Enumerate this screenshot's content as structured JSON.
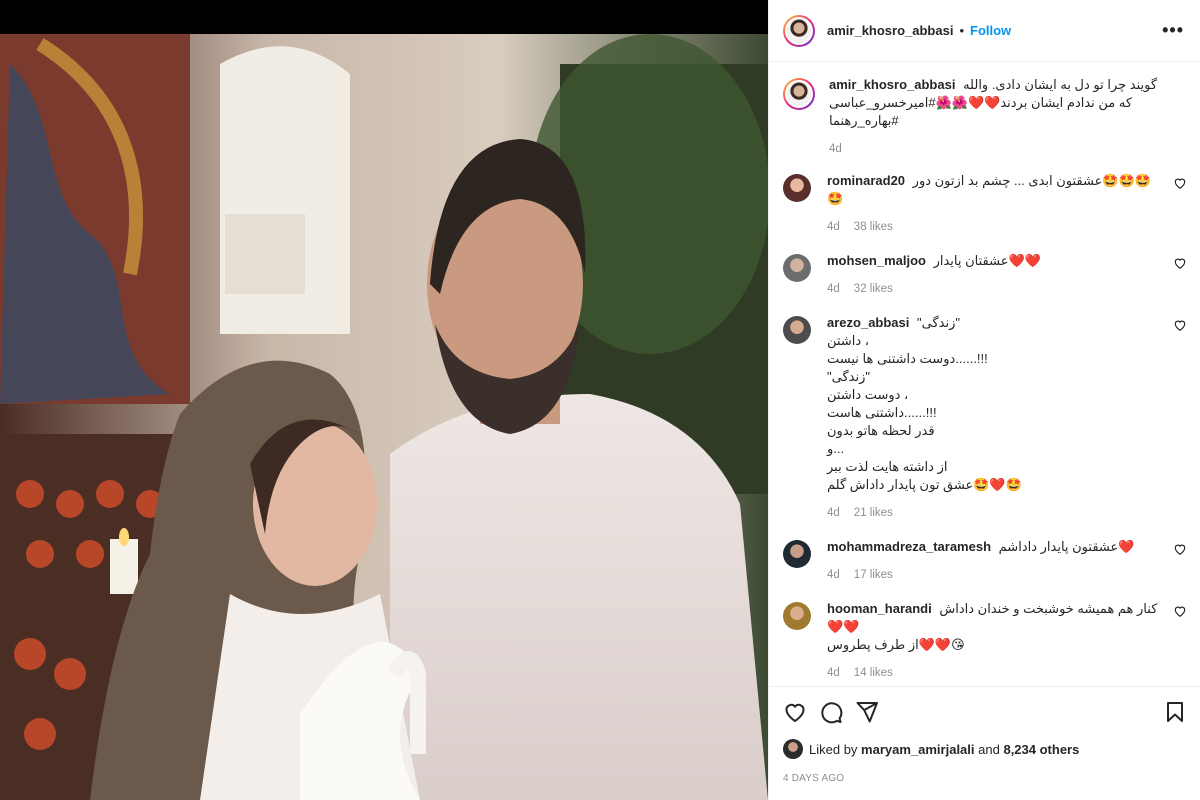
{
  "post": {
    "username": "amir_khosro_abbasi",
    "follow_label": "Follow",
    "dot": "•",
    "more_label": "•••",
    "caption_text": "گویند چرا تو دل به ایشان دادی. والله که من ندادم ایشان بردند❤️❤️🌺🌺#امیرخسرو_عباسی #بهاره_رهنما",
    "caption_time": "4d"
  },
  "comments": [
    {
      "user": "rominarad20",
      "text": "🤩🤩🤩عشقتون ابدی ... چشم بد ازتون دور 🤩",
      "time": "4d",
      "likes": "38 likes"
    },
    {
      "user": "mohsen_maljoo",
      "text": "❤️❤️عشقتان پایدار",
      "time": "4d",
      "likes": "32 likes"
    },
    {
      "user": "arezo_abbasi",
      "text": "\"زندگی\"\n، داشتن\n!!!......دوست داشتنی ها نیست\n\"زندگی\"\n، دوست داشتن\n!!!......داشتنی هاست\nقدر لحظه هاتو بدون\n...و\nاز داشته هایت لذت ببر\n🤩❤️🤩عشق تون پایدار داداش گلم",
      "time": "4d",
      "likes": "21 likes"
    },
    {
      "user": "mohammadreza_taramesh",
      "text": "❤️عشقتون پایدار داداشم",
      "time": "4d",
      "likes": "17 likes"
    },
    {
      "user": "hooman_harandi",
      "text": "کنار هم همیشه خوشبخت و خندان داداش❤️❤️\n😘❤️❤️از طرف پطروس",
      "time": "4d",
      "likes": "14 likes"
    }
  ],
  "actions": {
    "liked_by_prefix": "Liked by",
    "liked_by_user": "maryam_amirjalali",
    "liked_by_and": "and",
    "others": "8,234 others",
    "date": "4 DAYS AGO"
  },
  "colors": {
    "accent": "#0095f6",
    "heart": "#ed4956",
    "muted": "#8e8e8e"
  }
}
